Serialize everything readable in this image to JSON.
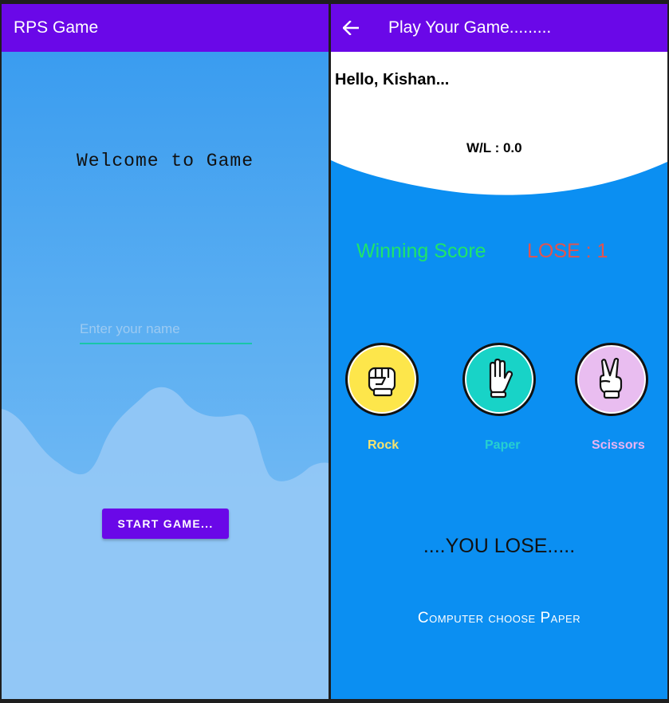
{
  "left_screen": {
    "appbar": {
      "title": "RPS Game"
    },
    "welcome_text": "Welcome to Game",
    "name_input": {
      "placeholder": "Enter your name",
      "value": ""
    },
    "start_button_label": "START GAME..."
  },
  "right_screen": {
    "appbar": {
      "title": "Play Your Game........."
    },
    "greeting": "Hello, Kishan...",
    "win_loss_ratio": "W/L : 0.0",
    "winning_score_label": "Winning Score",
    "lose_score_label": "LOSE : 1",
    "choices": [
      {
        "label": "Rock",
        "icon": "fist-icon",
        "color": "#fde64b",
        "label_color": "#f6e36e"
      },
      {
        "label": "Paper",
        "icon": "open-hand-icon",
        "color": "#18d3c7",
        "label_color": "#26cfd0"
      },
      {
        "label": "Scissors",
        "icon": "victory-hand-icon",
        "color": "#e9bdf0",
        "label_color": "#e9b3f2"
      }
    ],
    "result_text": "....YOU LOSE.....",
    "computer_choice_text": "Computer choose Paper"
  },
  "colors": {
    "primary": "#6a08e8",
    "accent": "#19c6a8",
    "game_background": "#0b8ff2",
    "win": "#1fe46a",
    "lose": "#e4534d"
  }
}
